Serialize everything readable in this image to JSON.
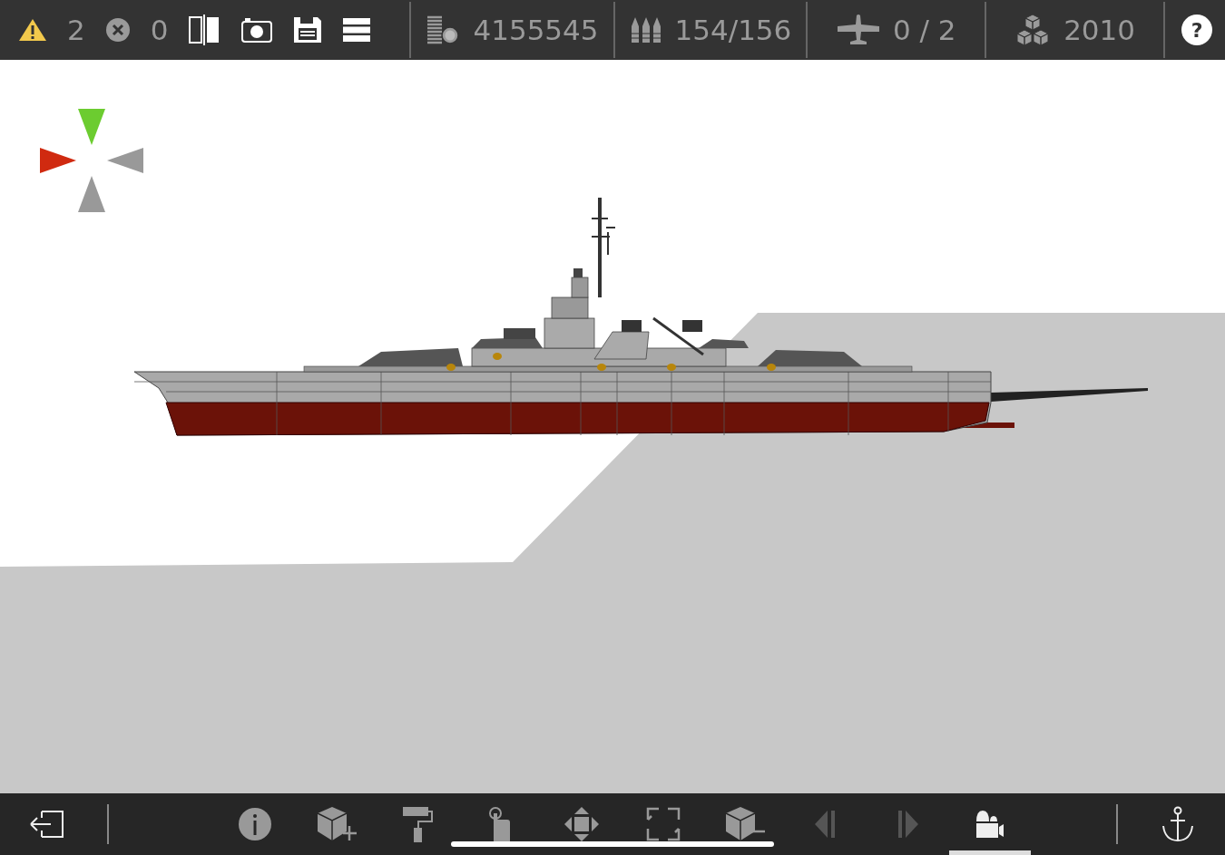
{
  "top_bar": {
    "warnings": "2",
    "errors": "0",
    "stats": [
      {
        "kind": "cost",
        "value": "4155545"
      },
      {
        "kind": "ammo",
        "value": "154/156"
      },
      {
        "kind": "aircraft",
        "value": "0 / 2"
      },
      {
        "kind": "year",
        "value": "2010"
      }
    ],
    "help_label": "?"
  },
  "toolbar": {
    "tools": [
      {
        "kind": "info",
        "selected": false,
        "disabled": false
      },
      {
        "kind": "add-part",
        "selected": false,
        "disabled": false
      },
      {
        "kind": "paint",
        "selected": false,
        "disabled": false
      },
      {
        "kind": "select",
        "selected": false,
        "disabled": false
      },
      {
        "kind": "move",
        "selected": false,
        "disabled": false
      },
      {
        "kind": "resize",
        "selected": false,
        "disabled": false
      },
      {
        "kind": "remove-part",
        "selected": false,
        "disabled": false
      },
      {
        "kind": "previous",
        "selected": false,
        "disabled": true
      },
      {
        "kind": "next",
        "selected": false,
        "disabled": true
      },
      {
        "kind": "camera",
        "selected": true,
        "disabled": false
      }
    ]
  }
}
